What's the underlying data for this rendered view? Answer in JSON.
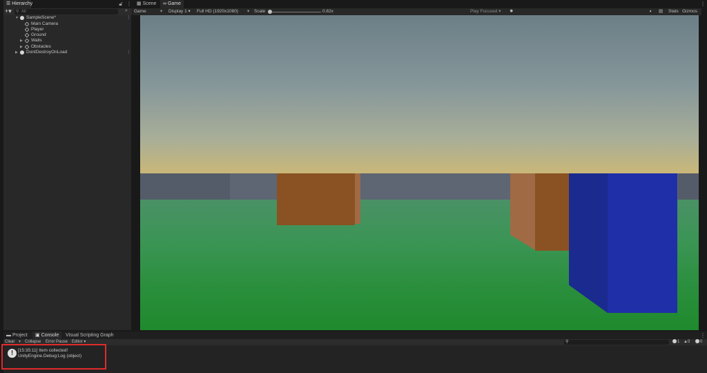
{
  "top_tabs": {
    "hierarchy": "Hierarchy",
    "scene": "Scene",
    "game": "Game"
  },
  "hierarchy": {
    "search_placeholder": "All",
    "items": [
      {
        "label": "SampleScene*",
        "type": "scene",
        "expanded": true
      },
      {
        "label": "Main Camera",
        "type": "gameobject"
      },
      {
        "label": "Player",
        "type": "gameobject"
      },
      {
        "label": "Ground",
        "type": "gameobject"
      },
      {
        "label": "Walls",
        "type": "gameobject",
        "collapsed": true
      },
      {
        "label": "Obstacles",
        "type": "gameobject",
        "collapsed": true
      },
      {
        "label": "DontDestroyOnLoad",
        "type": "scene",
        "collapsed": true
      }
    ]
  },
  "game_toolbar": {
    "view_mode": "Game",
    "display": "Display 1",
    "resolution": "Full HD (1920x1080)",
    "scale_label": "Scale",
    "scale_value": "0.82x",
    "play_mode": "Play Focused",
    "stats": "Stats",
    "gizmos": "Gizmos"
  },
  "bottom_tabs": {
    "project": "Project",
    "console": "Console",
    "visual_scripting": "Visual Scripting Graph"
  },
  "console_toolbar": {
    "clear": "Clear",
    "collapse": "Collapse",
    "error_pause": "Error Pause",
    "editor": "Editor",
    "log_count": "1",
    "warning_count": "0",
    "error_count": "0"
  },
  "console_log": {
    "line1": "[15:35:11] Item collected!",
    "line2": "UnityEngine.Debug:Log (object)"
  },
  "colors": {
    "highlight": "#e22b2b",
    "floor": "#2b8f3e",
    "obstacle": "#8a5222",
    "player_cube": "#1f2fa8"
  }
}
